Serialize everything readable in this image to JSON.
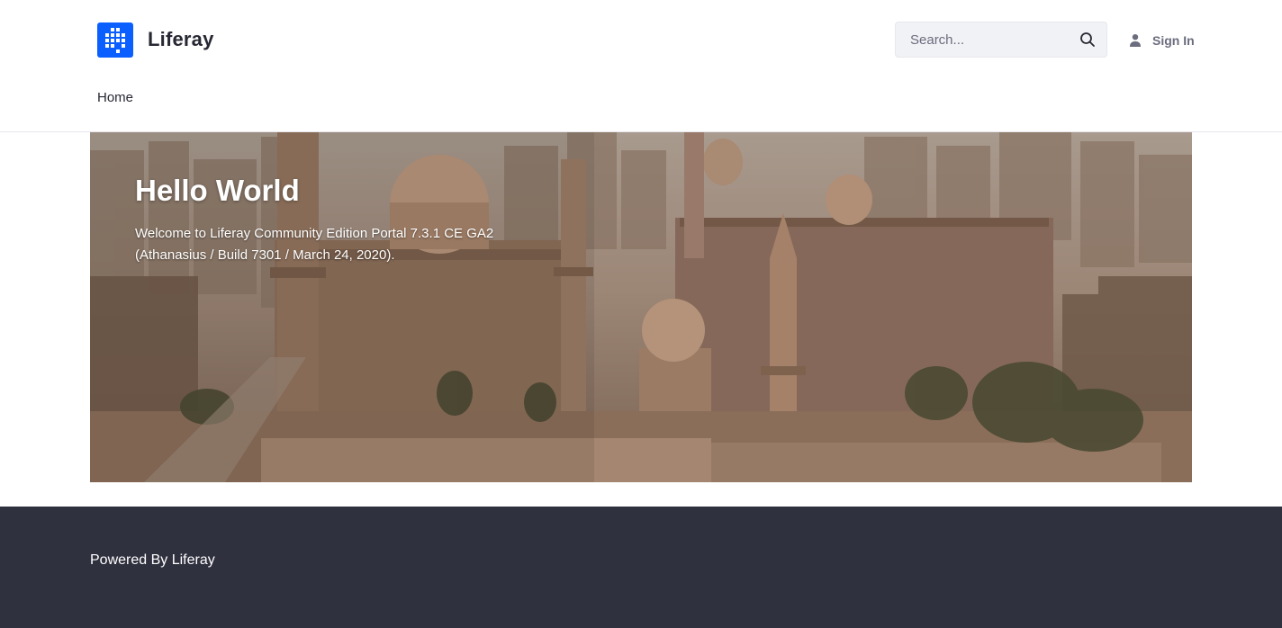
{
  "header": {
    "site_name": "Liferay",
    "search": {
      "placeholder": "Search..."
    },
    "sign_in_label": "Sign In"
  },
  "nav": {
    "items": [
      {
        "label": "Home"
      }
    ]
  },
  "hero": {
    "title": "Hello World",
    "text": "Welcome to Liferay Community Edition Portal 7.3.1 CE GA2 (Athanasius / Build 7301 / March 24, 2020)."
  },
  "footer": {
    "text": "Powered By Liferay"
  },
  "colors": {
    "brand_blue": "#0b5fff",
    "footer_bg": "#30313f",
    "hero_tone": "#b08c72"
  },
  "icons": {
    "logo": "liferay-logo-icon",
    "search": "search-icon",
    "user": "user-icon"
  }
}
